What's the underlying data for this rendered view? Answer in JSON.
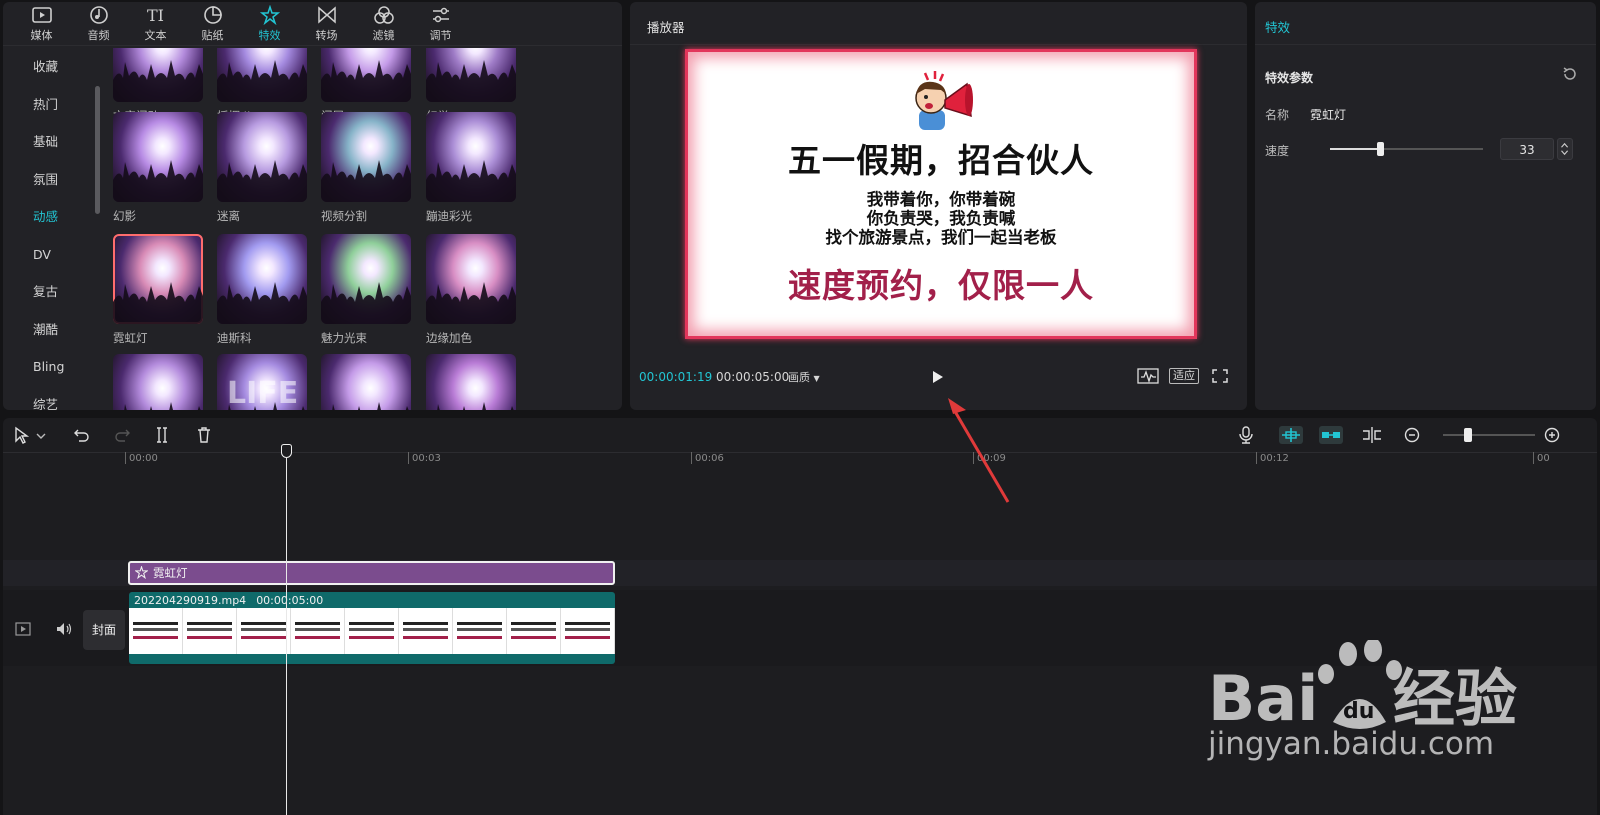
{
  "tool_tabs": [
    {
      "label": "媒体",
      "icon": "media-icon"
    },
    {
      "label": "音频",
      "icon": "audio-icon"
    },
    {
      "label": "文本",
      "icon": "text-icon"
    },
    {
      "label": "贴纸",
      "icon": "sticker-icon"
    },
    {
      "label": "特效",
      "icon": "effects-icon",
      "active": true
    },
    {
      "label": "转场",
      "icon": "transition-icon"
    },
    {
      "label": "滤镜",
      "icon": "filter-icon"
    },
    {
      "label": "调节",
      "icon": "adjust-icon"
    }
  ],
  "categories": [
    {
      "label": "收藏"
    },
    {
      "label": "热门"
    },
    {
      "label": "基础"
    },
    {
      "label": "氛围"
    },
    {
      "label": "动感",
      "active": true
    },
    {
      "label": "DV"
    },
    {
      "label": "复古"
    },
    {
      "label": "潮酷"
    },
    {
      "label": "Bling"
    },
    {
      "label": "综艺"
    }
  ],
  "effects": [
    {
      "label": "文字闪动"
    },
    {
      "label": "摇摆 II"
    },
    {
      "label": "闪屏"
    },
    {
      "label": "幻觉"
    },
    {
      "label": "幻影"
    },
    {
      "label": "迷离"
    },
    {
      "label": "视频分割"
    },
    {
      "label": "蹦迪彩光"
    },
    {
      "label": "霓虹灯",
      "selected": true
    },
    {
      "label": "迪斯科"
    },
    {
      "label": "魅力光束"
    },
    {
      "label": "边缘加色"
    },
    {
      "label": ""
    },
    {
      "label": "",
      "overlay": "LIFE"
    },
    {
      "label": ""
    },
    {
      "label": ""
    }
  ],
  "player": {
    "title": "播放器",
    "headline": "五一假期，招合伙人",
    "sub_lines": [
      "我带着你，你带着碗",
      "你负责哭，我负责喊",
      "找个旅游景点，我们一起当老板"
    ],
    "footer": "速度预约，仅限一人",
    "time_current": "00:00:01:19",
    "time_total": "00:00:05:00",
    "quality_label": "画质",
    "fit_label": "适应"
  },
  "props": {
    "title": "特效",
    "params_title": "特效参数",
    "name_label": "名称",
    "name_value": "霓虹灯",
    "speed_label": "速度",
    "speed_value": "33",
    "speed_fraction": 0.33
  },
  "timeline": {
    "ruler_labels": [
      "00:00",
      "00:03",
      "00:06",
      "00:09",
      "00:12",
      "00"
    ],
    "effect_clip_label": "霓虹灯",
    "video_clip_name": "20220429091​9.mp4",
    "video_clip_duration": "00:00:05:00",
    "cover_label": "封面"
  },
  "watermark": {
    "text": "jingyan.baidu.com",
    "brand": "Bai du 经验"
  },
  "colors": {
    "accent": "#22c5d3",
    "effect_clip": "#7b4c8e",
    "video_clip": "#0f6a6a",
    "annotation": "#e03a3a"
  }
}
